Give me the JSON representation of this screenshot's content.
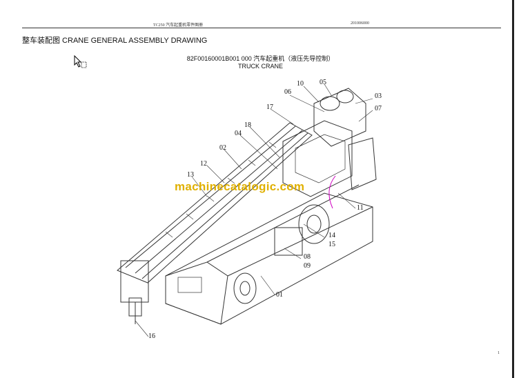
{
  "header": {
    "left_text": "TC250  汽车起重机零件图册",
    "right_text": "201006000"
  },
  "section_title": "整车装配图  CRANE GENERAL ASSEMBLY DRAWING",
  "drawing": {
    "code_line": "82F00160001B001 000  汽车起重机（液压先导控制）",
    "name_line": "TRUCK CRANE"
  },
  "watermark": "machinecatalogic.com",
  "page_number": "1",
  "callouts": {
    "c10": "10",
    "c05": "05",
    "c06": "06",
    "c03": "03",
    "c07": "07",
    "c17": "17",
    "c18": "18",
    "c04": "04",
    "c02": "02",
    "c12": "12",
    "c13": "13",
    "c11": "11",
    "c14": "14",
    "c15": "15",
    "c08": "08",
    "c09": "09",
    "c01": "01",
    "c16": "16"
  },
  "icons": {
    "cursor": "arrow-pointer-icon"
  }
}
